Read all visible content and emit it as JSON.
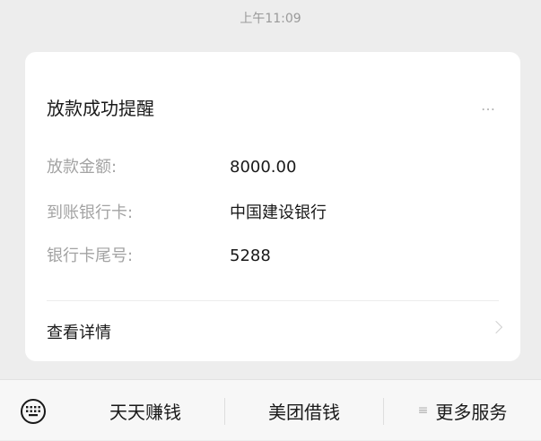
{
  "timestamp": "上午11:09",
  "card": {
    "title": "放款成功提醒",
    "more_icon": "…",
    "rows": [
      {
        "label": "放款金额:",
        "value": "8000.00"
      },
      {
        "label": "到账银行卡:",
        "value": "中国建设银行"
      },
      {
        "label": "银行卡尾号:",
        "value": "5288"
      }
    ],
    "details_label": "查看详情"
  },
  "bottom_menu": {
    "items": [
      {
        "label": "天天赚钱"
      },
      {
        "label": "美团借钱"
      },
      {
        "label": "更多服务",
        "icon": "≡"
      }
    ]
  }
}
